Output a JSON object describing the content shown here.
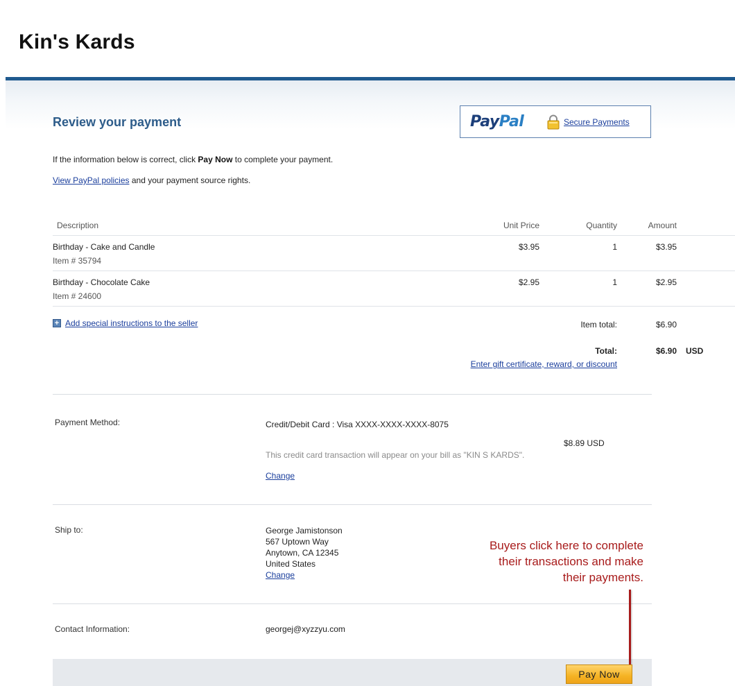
{
  "store": {
    "title": "Kin's Kards"
  },
  "header": {
    "heading": "Review your payment",
    "paypal_logo_pay": "Pay",
    "paypal_logo_pal": "Pal",
    "secure_link": "Secure Payments"
  },
  "intro": {
    "prefix": "If the information below is correct, click ",
    "bold": "Pay Now",
    "suffix": " to complete your payment.",
    "policy_link": "View PayPal policies",
    "policy_suffix": " and your payment source rights."
  },
  "table": {
    "headers": {
      "description": "Description",
      "unit_price": "Unit Price",
      "quantity": "Quantity",
      "amount": "Amount"
    },
    "items": [
      {
        "name": "Birthday - Cake and Candle",
        "item_no": "Item # 35794",
        "unit_price": "$3.95",
        "quantity": "1",
        "amount": "$3.95"
      },
      {
        "name": "Birthday - Chocolate Cake",
        "item_no": "Item # 24600",
        "unit_price": "$2.95",
        "quantity": "1",
        "amount": "$2.95"
      }
    ],
    "instructions_link": "Add special instructions to the seller",
    "item_total_label": "Item total:",
    "item_total_value": "$6.90",
    "total_label": "Total:",
    "total_value": "$6.90",
    "currency": "USD",
    "gift_link": "Enter gift certificate, reward, or discount"
  },
  "payment": {
    "label": "Payment Method:",
    "method": "Credit/Debit Card : Visa XXXX-XXXX-XXXX-8075",
    "amount": "$8.89 USD",
    "note": "This credit card transaction will appear on your bill as \"KIN S KARDS\".",
    "change": "Change"
  },
  "ship": {
    "label": "Ship to:",
    "name": "George Jamistonson",
    "street": "567 Uptown Way",
    "city": "Anytown, CA 12345",
    "country": "United States",
    "change": "Change"
  },
  "contact": {
    "label": "Contact Information:",
    "email": "georgej@xyzzyu.com"
  },
  "annotation": {
    "line1": "Buyers click here to complete",
    "line2": "their transactions and make",
    "line3": "their payments."
  },
  "actions": {
    "pay_now": "Pay Now"
  },
  "colors": {
    "accent": "#1f5a8f",
    "heading": "#2d5c8a",
    "link": "#1a3e9c",
    "button": "#f5b324",
    "annotation": "#a81b1b"
  }
}
